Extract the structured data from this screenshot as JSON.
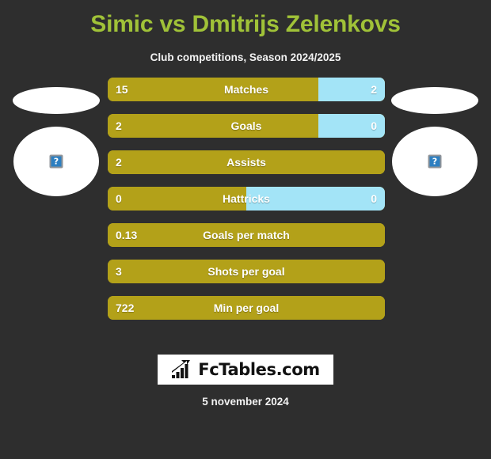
{
  "header": {
    "title": "Simic vs Dmitrijs Zelenkovs",
    "subtitle": "Club competitions, Season 2024/2025",
    "title_color": "#a0c238"
  },
  "players": {
    "left": {
      "avatar_alt": "?"
    },
    "right": {
      "avatar_alt": "?"
    }
  },
  "colors": {
    "background": "#2e2e2e",
    "bar_left": "#b3a119",
    "bar_right": "#a3e4f7",
    "text": "#ffffff"
  },
  "chart_data": {
    "type": "bar",
    "title": "Simic vs Dmitrijs Zelenkovs",
    "subtitle": "Club competitions, Season 2024/2025",
    "orientation": "horizontal-diverging",
    "series": [
      {
        "name": "Simic",
        "color": "#b3a119"
      },
      {
        "name": "Dmitrijs Zelenkovs",
        "color": "#a3e4f7"
      }
    ],
    "categories": [
      "Matches",
      "Goals",
      "Assists",
      "Hattricks",
      "Goals per match",
      "Shots per goal",
      "Min per goal"
    ],
    "rows": [
      {
        "label": "Matches",
        "left_value": "15",
        "right_value": "2",
        "left_pct": 76,
        "right_pct": 24
      },
      {
        "label": "Goals",
        "left_value": "2",
        "right_value": "0",
        "left_pct": 76,
        "right_pct": 24
      },
      {
        "label": "Assists",
        "left_value": "2",
        "right_value": "",
        "left_pct": 100,
        "right_pct": 0
      },
      {
        "label": "Hattricks",
        "left_value": "0",
        "right_value": "0",
        "left_pct": 50,
        "right_pct": 50
      },
      {
        "label": "Goals per match",
        "left_value": "0.13",
        "right_value": "",
        "left_pct": 100,
        "right_pct": 0
      },
      {
        "label": "Shots per goal",
        "left_value": "3",
        "right_value": "",
        "left_pct": 100,
        "right_pct": 0
      },
      {
        "label": "Min per goal",
        "left_value": "722",
        "right_value": "",
        "left_pct": 100,
        "right_pct": 0
      }
    ]
  },
  "footer": {
    "logo_text": "FcTables.com",
    "logo_icon": "bar-chart-trend-icon",
    "date": "5 november 2024"
  }
}
